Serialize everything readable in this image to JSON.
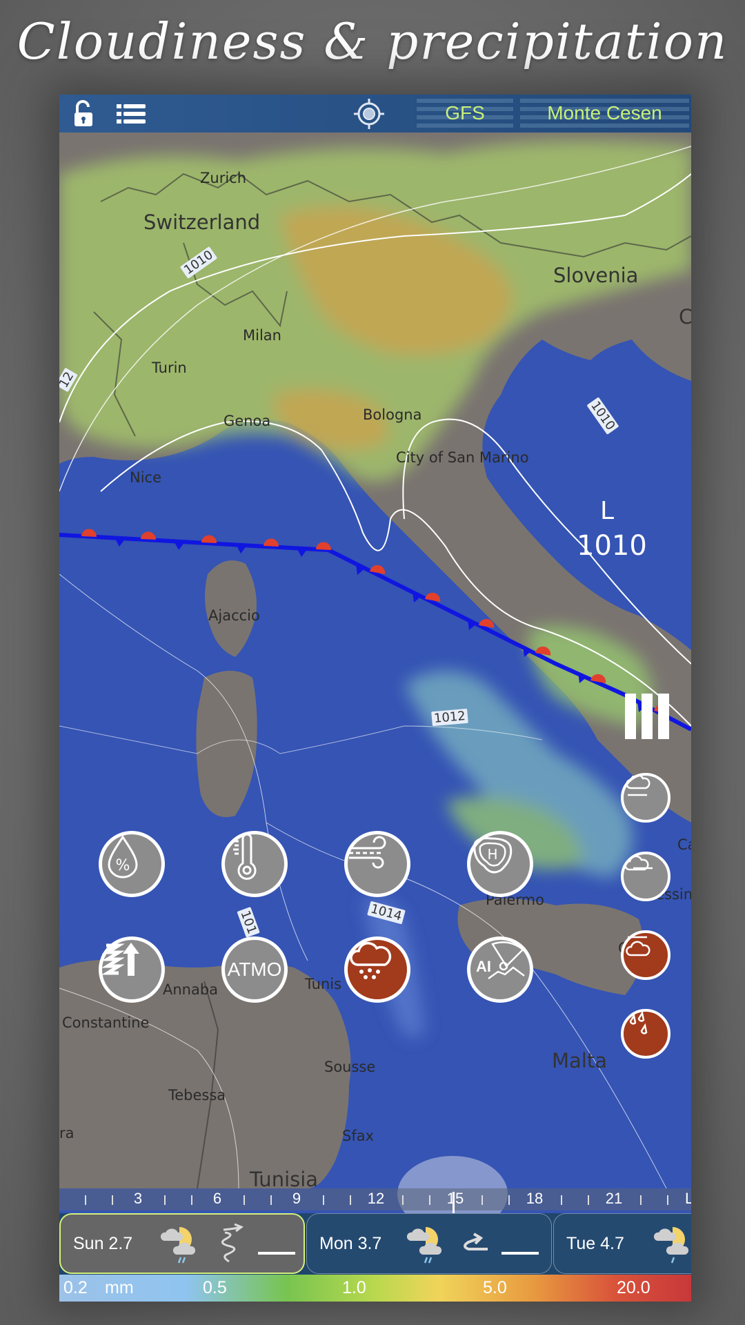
{
  "promo": {
    "title": "Cloudiness & precipitation"
  },
  "topbar": {
    "lock_icon": "unlocked-padlock-icon",
    "menu_icon": "list-menu-icon",
    "locate_icon": "crosshair-location-icon",
    "model": "GFS",
    "location": "Monte Cesen"
  },
  "map": {
    "places": {
      "zurich": "Zurich",
      "switzerland": "Switzerland",
      "slovenia": "Slovenia",
      "milan": "Milan",
      "turin": "Turin",
      "genoa": "Genoa",
      "bologna": "Bologna",
      "nice": "Nice",
      "san_marino": "City of San Marino",
      "ajaccio": "Ajaccio",
      "palermo": "Palermo",
      "messina": "Messina",
      "catania": "Cat",
      "tunis": "Tunis",
      "annaba": "Annaba",
      "constantine": "Constantine",
      "sousse": "Sousse",
      "tebessa": "Tebessa",
      "sfax": "Sfax",
      "malta": "Malta",
      "tunisia": "Tunisia",
      "edge_ra": "ra",
      "edge_c": "C",
      "edge_ca": "Ca"
    },
    "isobars": {
      "a": "1010",
      "b": "1010",
      "c": "1012",
      "d": "1014",
      "e": "101",
      "f": "12"
    },
    "pressure_center": {
      "type": "L",
      "value": "1010"
    }
  },
  "layer_buttons": [
    {
      "name": "humidity",
      "icon": "humidity-drop-percent-icon",
      "active": false
    },
    {
      "name": "temperature",
      "icon": "thermometer-icon",
      "active": false
    },
    {
      "name": "wind",
      "icon": "wind-icon",
      "active": false
    },
    {
      "name": "pressure",
      "icon": "high-pressure-icon",
      "active": false
    },
    {
      "name": "thermals",
      "icon": "thermal-updraft-icon",
      "active": false
    },
    {
      "name": "atmo",
      "label": "ATMO",
      "active": false
    },
    {
      "name": "cloud-precip",
      "icon": "cloud-rain-icon",
      "active": true
    },
    {
      "name": "ai-paragliding",
      "label": "AI",
      "icon": "paraglider-icon",
      "active": false
    }
  ],
  "side_buttons": [
    {
      "name": "high-cloud",
      "icon": "cloud-above-line-icon",
      "active": false
    },
    {
      "name": "mid-cloud",
      "icon": "cloud-on-line-icon",
      "active": false
    },
    {
      "name": "low-cloud",
      "icon": "cloud-below-line-icon",
      "active": true
    },
    {
      "name": "precipitation",
      "icon": "rain-drops-icon",
      "active": true
    }
  ],
  "timeline": {
    "ticks": [
      "3",
      "6",
      "9",
      "12",
      "15",
      "18",
      "21",
      "LT"
    ],
    "current_hour": "15"
  },
  "days": [
    {
      "label": "Sun 2.7",
      "weather_icon": "partly-cloudy-rain-icon",
      "wind_icon": "wind-gust-icon",
      "selected": true
    },
    {
      "label": "Mon 3.7",
      "weather_icon": "partly-cloudy-rain-icon",
      "wind_icon": "wind-arrow-icon",
      "selected": false
    },
    {
      "label": "Tue 4.7",
      "weather_icon": "partly-cloudy-rain-icon",
      "selected": false
    }
  ],
  "legend": {
    "unit": "mm",
    "stops": [
      "0.2",
      "0.5",
      "1.0",
      "5.0",
      "20.0"
    ]
  }
}
